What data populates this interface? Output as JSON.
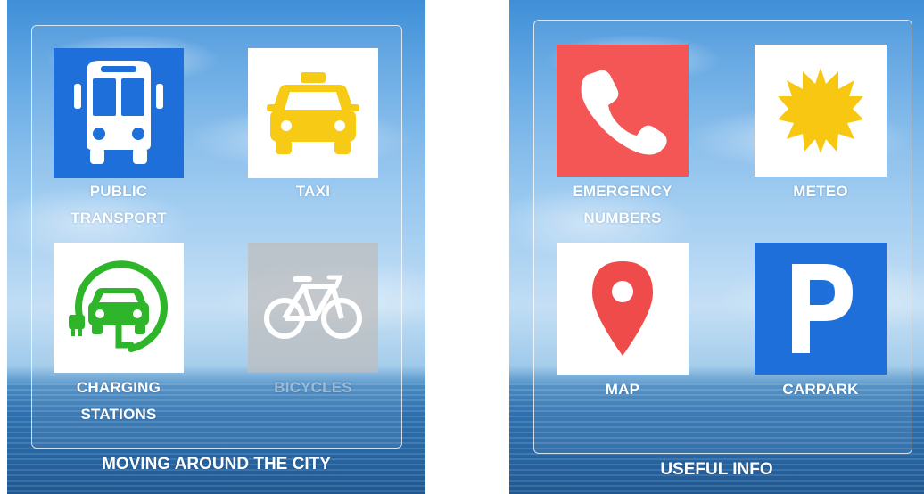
{
  "panels": [
    {
      "title": "MOVING AROUND THE CITY",
      "tiles": [
        {
          "label": "PUBLIC\nTRANSPORT",
          "icon": "bus-icon",
          "bg": "#1e6fd9",
          "fg": "#ffffff"
        },
        {
          "label": "TAXI",
          "icon": "taxi-icon",
          "bg": "#ffffff",
          "fg": "#f7cb15"
        },
        {
          "label": "CHARGING\nSTATIONS",
          "icon": "ev-charging-icon",
          "bg": "#ffffff",
          "fg": "#2fb52a"
        },
        {
          "label": "BICYCLES",
          "icon": "bicycle-icon",
          "bg": "#bdbdbd",
          "fg": "#ffffff",
          "disabled": true
        }
      ]
    },
    {
      "title": "USEFUL INFO",
      "tiles": [
        {
          "label": "EMERGENCY\nNUMBERS",
          "icon": "phone-icon",
          "bg": "#f45656",
          "fg": "#ffffff"
        },
        {
          "label": "METEO",
          "icon": "sun-icon",
          "bg": "#ffffff",
          "fg": "#f7c712"
        },
        {
          "label": "MAP",
          "icon": "map-pin-icon",
          "bg": "#ffffff",
          "fg": "#ef4b4b"
        },
        {
          "label": "CARPARK",
          "icon": "parking-icon",
          "bg": "#1e6fd9",
          "fg": "#ffffff"
        }
      ]
    }
  ]
}
